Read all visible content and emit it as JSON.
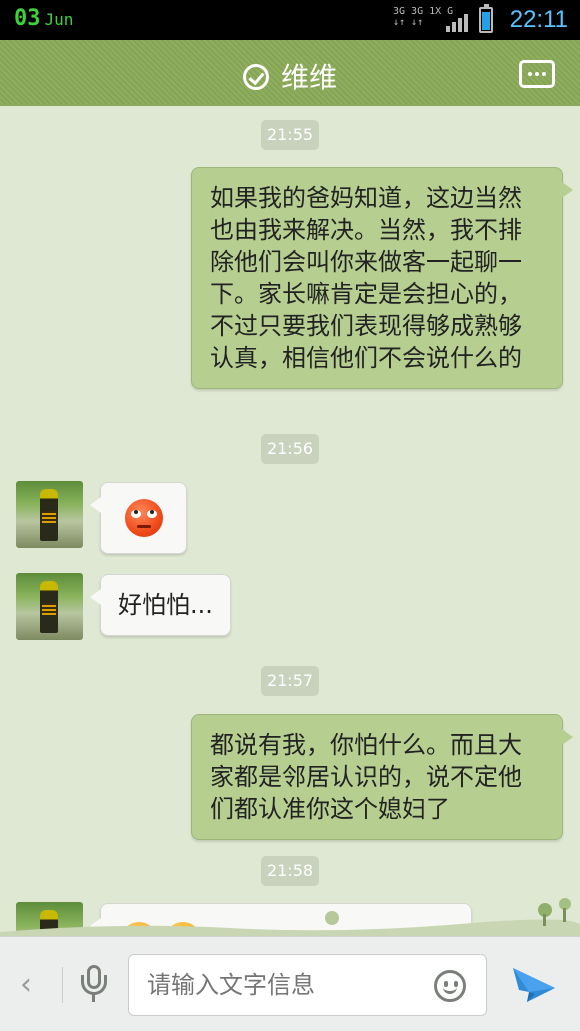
{
  "status_bar": {
    "day": "03",
    "month": "Jun",
    "network": [
      "3G 3G 1X G",
      "↓↑  ↓↑"
    ],
    "time": "22:11",
    "battery_level": 0.8
  },
  "header": {
    "title": "维维"
  },
  "messages": [
    {
      "type": "timestamp",
      "text": "21:55"
    },
    {
      "type": "sent",
      "text": "如果我的爸妈知道，这边当然也由我来解决。当然，我不排除他们会叫你来做客一起聊一下。家长嘛肯定是会担心的，不过只要我们表现得够成熟够认真，相信他们不会说什么的"
    },
    {
      "type": "timestamp",
      "text": "21:56"
    },
    {
      "type": "received",
      "emoji": "rolling-eyes-emoji"
    },
    {
      "type": "received",
      "text": "好怕怕..."
    },
    {
      "type": "timestamp",
      "text": "21:57"
    },
    {
      "type": "sent",
      "text": "都说有我，你怕什么。而且大家都是邻居认识的，说不定他们都认准你这个媳妇了"
    },
    {
      "type": "timestamp",
      "text": "21:58"
    },
    {
      "type": "received",
      "emoji": "smile-emoji"
    }
  ],
  "input_bar": {
    "placeholder": "请输入文字信息"
  },
  "colors": {
    "header": "#8aa95a",
    "sent_bubble": "#b6cf91",
    "received_bubble": "#f8f8f6",
    "background": "#dfe8d2",
    "time": "#5bc4ff",
    "date": "#3fd13b",
    "send_button": "#2f8ad8"
  }
}
